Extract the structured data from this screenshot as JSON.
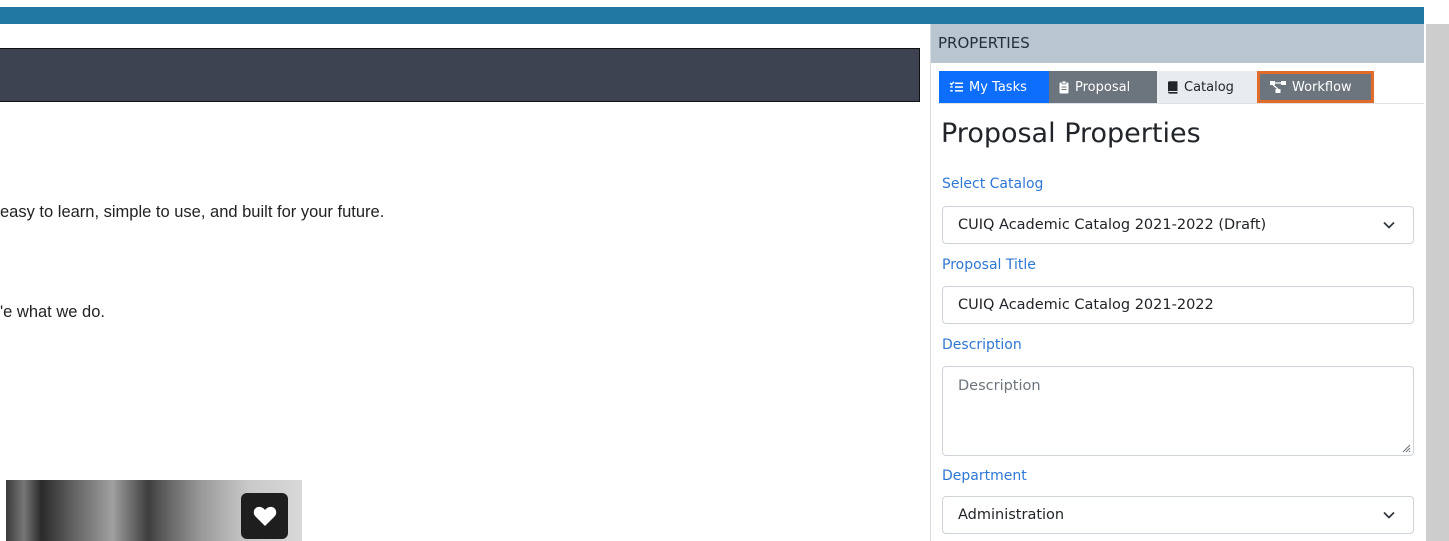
{
  "main": {
    "line1": "easy to learn, simple to use, and built for your future.",
    "line2": "'e what we do."
  },
  "panel": {
    "header": "PROPERTIES",
    "tabs": [
      {
        "label": "My Tasks",
        "icon": "tasks-icon"
      },
      {
        "label": "Proposal",
        "icon": "clipboard-icon"
      },
      {
        "label": "Catalog",
        "icon": "book-icon"
      },
      {
        "label": "Workflow",
        "icon": "workflow-icon"
      }
    ],
    "title": "Proposal Properties",
    "fields": {
      "catalog": {
        "label": "Select Catalog",
        "value": "CUIQ Academic Catalog 2021-2022 (Draft)"
      },
      "proposal_title": {
        "label": "Proposal Title",
        "value": "CUIQ Academic Catalog 2021-2022"
      },
      "description": {
        "label": "Description",
        "placeholder": "Description"
      },
      "department": {
        "label": "Department",
        "value": "Administration"
      }
    }
  },
  "colors": {
    "topbar": "#2179a3",
    "accent_blue": "#0d6efd",
    "label_blue": "#2f77d4",
    "workflow_highlight": "#e06b2b"
  }
}
